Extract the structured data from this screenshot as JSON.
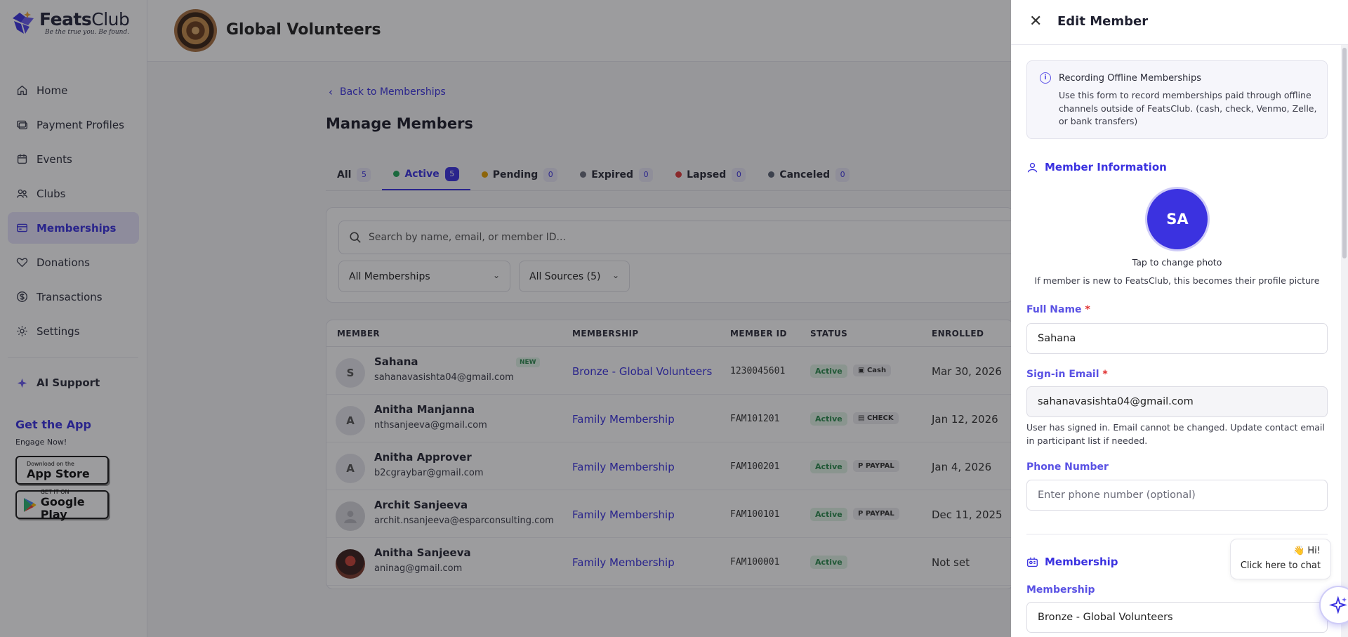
{
  "brand": {
    "name_bold": "Feats",
    "name_light": "Club",
    "tagline": "Be the true you. Be found."
  },
  "sidebar": {
    "items": [
      {
        "label": "Home"
      },
      {
        "label": "Payment Profiles"
      },
      {
        "label": "Events"
      },
      {
        "label": "Clubs"
      },
      {
        "label": "Memberships"
      },
      {
        "label": "Donations"
      },
      {
        "label": "Transactions"
      },
      {
        "label": "Settings"
      }
    ],
    "active_item": "Memberships",
    "ai_support": "AI Support",
    "get_app": "Get the App",
    "engage": "Engage Now!",
    "app_store": {
      "small": "Download on the",
      "big": "App Store"
    },
    "google_play": {
      "small": "GET IT ON",
      "big": "Google Play"
    }
  },
  "header": {
    "club_name": "Global Volunteers"
  },
  "main": {
    "back_link": "Back to Memberships",
    "title": "Manage Members",
    "tabs": [
      {
        "label": "All",
        "count": "5",
        "dot": ""
      },
      {
        "label": "Active",
        "count": "5",
        "dot": "#22a85a"
      },
      {
        "label": "Pending",
        "count": "0",
        "dot": "#e5a100"
      },
      {
        "label": "Expired",
        "count": "0",
        "dot": "#6b6e7d"
      },
      {
        "label": "Lapsed",
        "count": "0",
        "dot": "#e03c3c"
      },
      {
        "label": "Canceled",
        "count": "0",
        "dot": "#5c6476"
      }
    ],
    "search_placeholder": "Search by name, email, or member ID...",
    "filter_membership": "All Memberships",
    "filter_source": "All Sources (5)",
    "table": {
      "headers": [
        "MEMBER",
        "MEMBERSHIP",
        "MEMBER ID",
        "STATUS",
        "ENROLLED"
      ],
      "rows": [
        {
          "initial": "S",
          "name": "Sahana",
          "email": "sahanavasishta04@gmail.com",
          "badge": "NEW",
          "plan": "Bronze - Global Volunteers",
          "member_id": "1230045601",
          "status": "Active",
          "source": "Cash",
          "enrolled": "Mar 30, 2026"
        },
        {
          "initial": "A",
          "name": "Anitha Manjanna",
          "email": "nthsanjeeva@gmail.com",
          "badge": "",
          "plan": "Family Membership",
          "member_id": "FAM101201",
          "status": "Active",
          "source": "CHECK",
          "enrolled": "Jan 12, 2026"
        },
        {
          "initial": "A",
          "name": "Anitha Approver",
          "email": "b2cgraybar@gmail.com",
          "badge": "",
          "plan": "Family Membership",
          "member_id": "FAM100201",
          "status": "Active",
          "source": "PAYPAL",
          "enrolled": "Jan 4, 2026"
        },
        {
          "initial": "",
          "name": "Archit Sanjeeva",
          "email": "archit.nsanjeeva@esparconsulting.com",
          "badge": "",
          "plan": "Family Membership",
          "member_id": "FAM100101",
          "status": "Active",
          "source": "PAYPAL",
          "enrolled": "Dec 11, 2025"
        },
        {
          "initial": "",
          "name": "Anitha Sanjeeva",
          "email": "aninag@gmail.com",
          "badge": "",
          "plan": "Family Membership",
          "member_id": "FAM100001",
          "status": "Active",
          "source": "",
          "enrolled": "Not set"
        }
      ]
    }
  },
  "drawer": {
    "title": "Edit Member",
    "info_title": "Recording Offline Memberships",
    "info_text": "Use this form to record memberships paid through offline channels outside of FeatsClub. (cash, check, Venmo, Zelle, or bank transfers)",
    "member_section": "Member Information",
    "avatar_initials": "SA",
    "tap_photo": "Tap to change photo",
    "photo_note": "If member is new to FeatsClub, this becomes their profile picture",
    "full_name_label": "Full Name",
    "full_name_value": "Sahana",
    "email_label": "Sign-in Email",
    "email_value": "sahanavasishta04@gmail.com",
    "email_hint": "User has signed in. Email cannot be changed. Update contact email in participant list if needed.",
    "phone_label": "Phone Number",
    "phone_placeholder": "Enter phone number (optional)",
    "membership_section": "Membership",
    "membership_label": "Membership",
    "membership_value": "Bronze - Global Volunteers",
    "required_mark": "*"
  },
  "chat": {
    "hi": "👋 Hi!",
    "text": "Click here to chat"
  },
  "colors": {
    "accent": "#3b32e0",
    "active_bg": "#e7e4fb"
  }
}
